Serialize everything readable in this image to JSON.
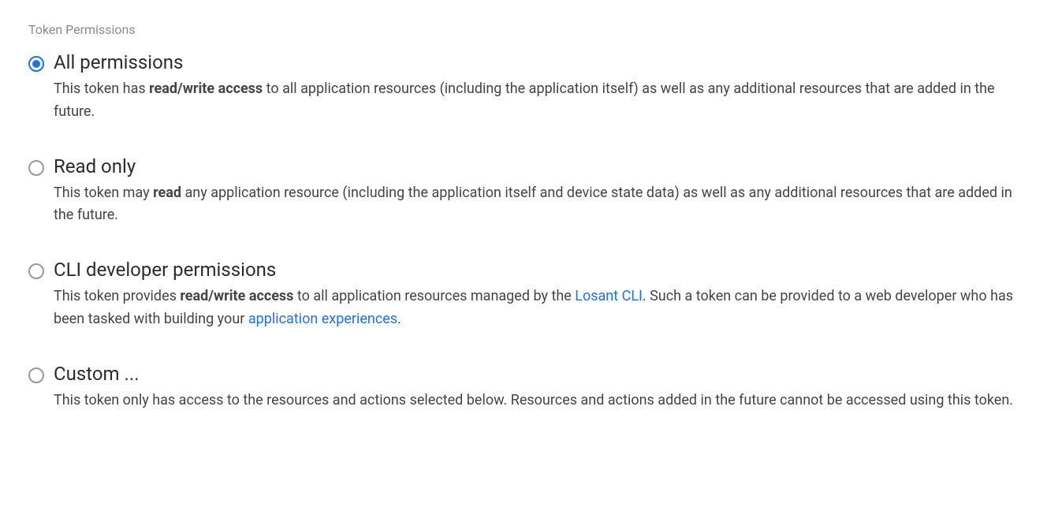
{
  "section_label": "Token Permissions",
  "options": {
    "all": {
      "title": "All permissions",
      "desc_pre": "This token has ",
      "desc_strong": "read/write access",
      "desc_post": " to all application resources (including the application itself) as well as any additional resources that are added in the future."
    },
    "read": {
      "title": "Read only",
      "desc_pre": "This token may ",
      "desc_strong": "read",
      "desc_post": " any application resource (including the application itself and device state data) as well as any additional resources that are added in the future."
    },
    "cli": {
      "title": "CLI developer permissions",
      "desc_pre": "This token provides ",
      "desc_strong": "read/write access",
      "desc_mid1": " to all application resources managed by the ",
      "link1": "Losant CLI",
      "desc_mid2": ". Such a token can be provided to a web developer who has been tasked with building your ",
      "link2": "application experiences",
      "desc_post": "."
    },
    "custom": {
      "title": "Custom ...",
      "desc": "This token only has access to the resources and actions selected below. Resources and actions added in the future cannot be accessed using this token."
    }
  }
}
